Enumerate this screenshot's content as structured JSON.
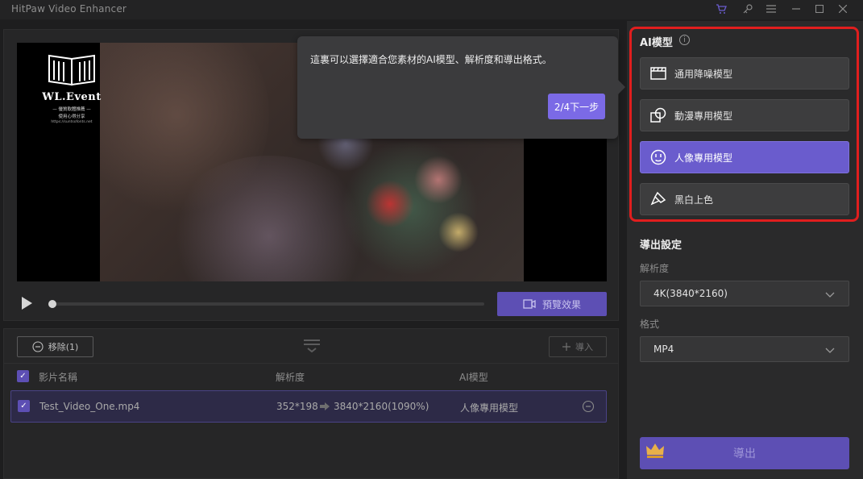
{
  "app": {
    "title": "HitPaw Video Enhancer"
  },
  "titlebar_icons": [
    "cart-icon",
    "key-icon",
    "menu-icon",
    "minimize-icon",
    "maximize-icon",
    "close-icon"
  ],
  "watermark": {
    "name": "WL.Event",
    "line1": "— 優質軟體推薦 —",
    "line2": "使用心得分享",
    "url": "https://suntsofonts.net"
  },
  "preview": {
    "button_label": "預覽效果",
    "progress": 0
  },
  "tooltip": {
    "text": "這裏可以選擇適合您素材的AI模型、解析度和導出格式。",
    "next_label": "2/4下一步"
  },
  "file_list": {
    "remove_label": "移除(1)",
    "import_label": "導入",
    "columns": [
      "影片名稱",
      "解析度",
      "AI模型"
    ],
    "rows": [
      {
        "name": "Test_Video_One.mp4",
        "from_res": "352*198",
        "to_res": "3840*2160(1090%)",
        "model": "人像專用模型"
      }
    ]
  },
  "ai_model": {
    "title": "AI模型",
    "options": [
      {
        "label": "通用降噪模型",
        "icon": "film-icon",
        "active": false
      },
      {
        "label": "動漫專用模型",
        "icon": "anime-shapes-icon",
        "active": false
      },
      {
        "label": "人像專用模型",
        "icon": "face-icon",
        "active": true
      },
      {
        "label": "黑白上色",
        "icon": "paint-brush-icon",
        "active": false
      }
    ]
  },
  "export_settings": {
    "title": "導出設定",
    "resolution_label": "解析度",
    "resolution_value": "4K(3840*2160)",
    "format_label": "格式",
    "format_value": "MP4",
    "export_label": "導出"
  },
  "colors": {
    "accent": "#6a5ccd",
    "highlight_frame": "#e01e1e"
  }
}
